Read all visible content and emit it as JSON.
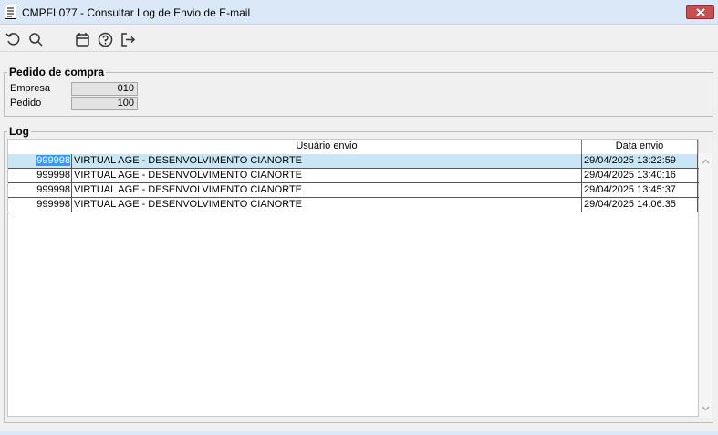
{
  "window": {
    "title": "CMPFL077 - Consultar Log de Envio de E-mail",
    "close_label": "✕"
  },
  "toolbar": {
    "buttons": [
      {
        "icon": "undo-icon"
      },
      {
        "icon": "search-icon"
      },
      {
        "icon": "calendar-icon"
      },
      {
        "icon": "help-icon"
      },
      {
        "icon": "exit-icon"
      }
    ]
  },
  "pedido": {
    "group_title": "Pedido de compra",
    "empresa_label": "Empresa",
    "empresa_value": "010",
    "pedido_label": "Pedido",
    "pedido_value": "100"
  },
  "log": {
    "group_title": "Log",
    "columns": {
      "usuario": "Usuário envio",
      "data": "Data envio"
    },
    "rows": [
      {
        "code": "999998",
        "usuario": "VIRTUAL AGE - DESENVOLVIMENTO CIANORTE",
        "data": "29/04/2025 13:22:59"
      },
      {
        "code": "999998",
        "usuario": "VIRTUAL AGE - DESENVOLVIMENTO CIANORTE",
        "data": "29/04/2025 13:40:16"
      },
      {
        "code": "999998",
        "usuario": "VIRTUAL AGE - DESENVOLVIMENTO CIANORTE",
        "data": "29/04/2025 13:45:37"
      },
      {
        "code": "999998",
        "usuario": "VIRTUAL AGE - DESENVOLVIMENTO CIANORTE",
        "data": "29/04/2025 14:06:35"
      }
    ],
    "selected_row": 0
  },
  "colors": {
    "titlebar": "#dbe8f8",
    "close_button": "#c75050",
    "selected_row": "#c9e6f7",
    "selection_highlight": "#3399ff"
  }
}
